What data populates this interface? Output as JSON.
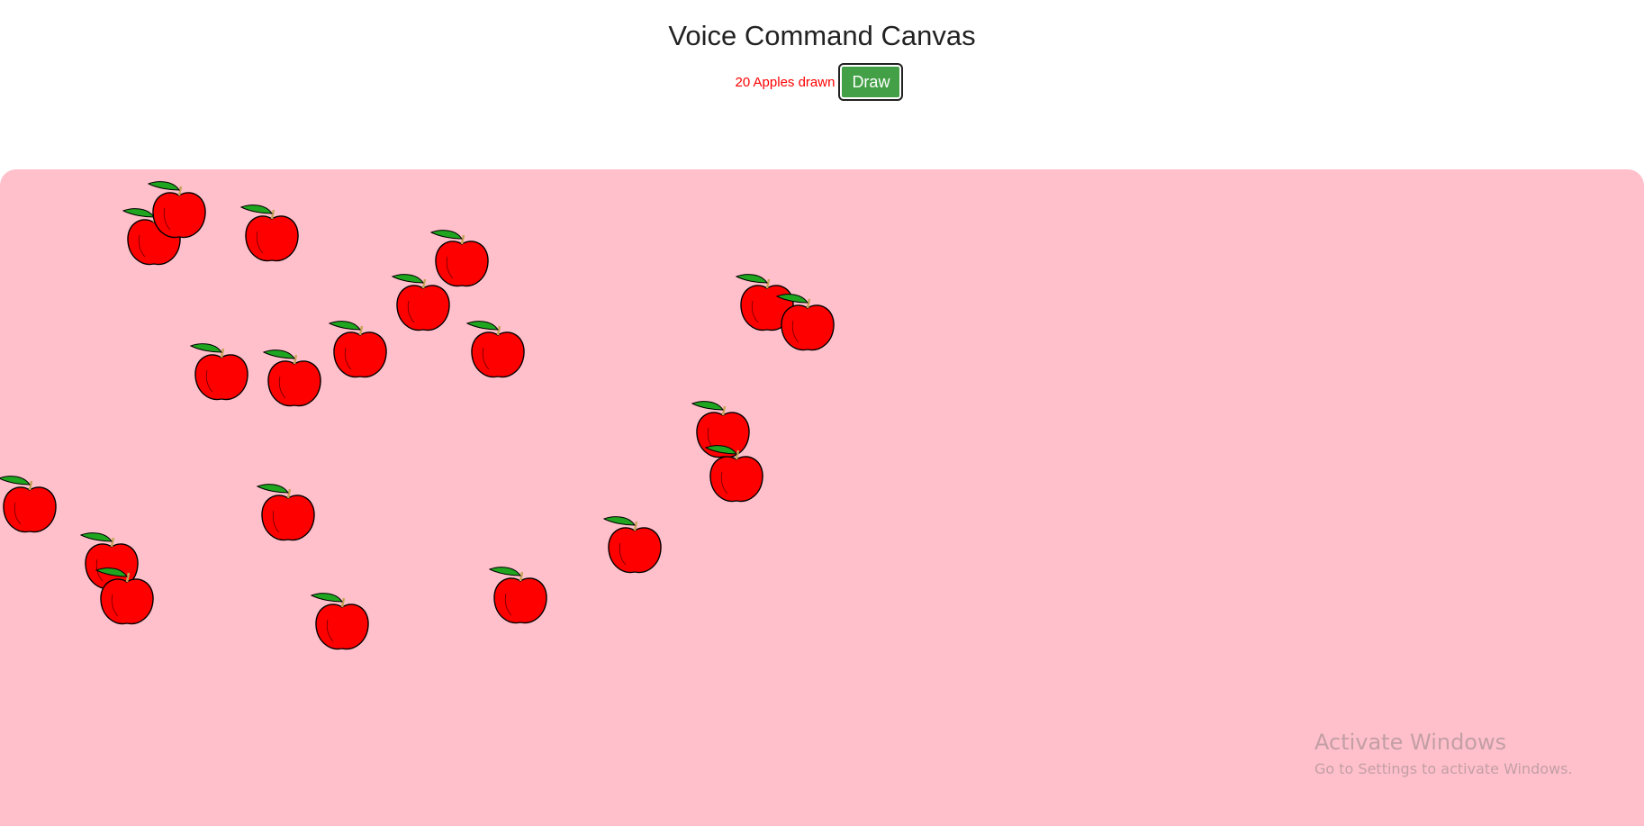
{
  "header": {
    "title": "Voice Command Canvas"
  },
  "controls": {
    "status_text": "20 Apples drawn",
    "draw_label": "Draw"
  },
  "canvas": {
    "background_color": "#ffc0cb",
    "apple_count": 20,
    "apple_color": "#ff0000",
    "leaf_color": "#1fa51f",
    "stem_color": "#c8a45a"
  },
  "watermark": {
    "title": "Activate Windows",
    "subtitle": "Go to Settings to activate Windows."
  },
  "colors": {
    "status_red": "#ff0000",
    "button_green": "#43a047"
  }
}
